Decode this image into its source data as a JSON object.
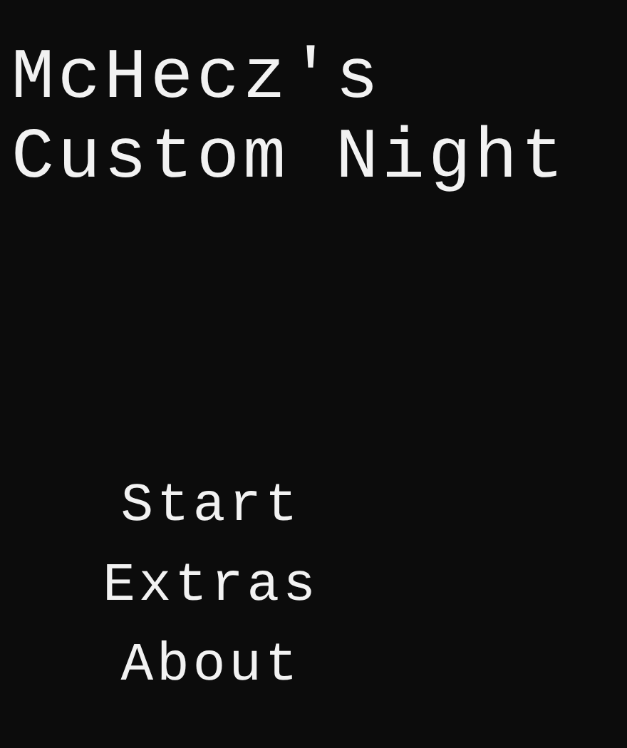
{
  "title": [
    "McHecz's",
    "Custom Night"
  ],
  "menu": [
    {
      "label": "Start"
    },
    {
      "label": "Extras"
    },
    {
      "label": "About"
    }
  ]
}
